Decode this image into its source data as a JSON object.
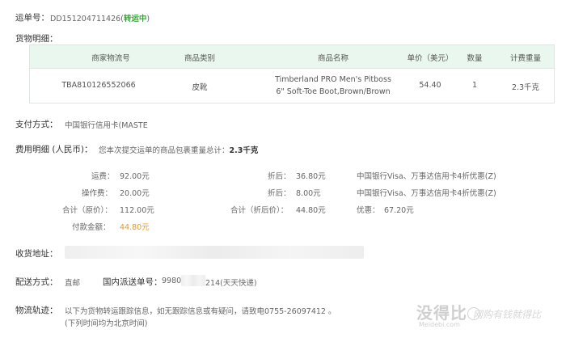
{
  "order": {
    "label": "运单号：",
    "number": "DD151204711426(",
    "status": "转运中",
    "close": ")"
  },
  "goods": {
    "label": "货物明细：",
    "headers": [
      "商家物流号",
      "商品类别",
      "商品名称",
      "单价（美元）",
      "数量",
      "计费重量"
    ],
    "row": {
      "tracking": "TBA810126552066",
      "category": "皮靴",
      "name": "Timberland PRO Men's Pitboss 6\" Soft-Toe Boot,Brown/Brown",
      "price": "54.40",
      "qty": "1",
      "weight": "2.3千克"
    }
  },
  "payment": {
    "label": "支付方式：",
    "method": "中国银行信用卡(MASTE"
  },
  "fees": {
    "label": "费用明细 (人民币)：",
    "summary_prefix": "您本次提交运单的商品包裹重量总计：",
    "summary_weight": "2.3千克",
    "freight_label": "运费：",
    "freight": "92.00元",
    "freight_disc_label": "折后：",
    "freight_disc": "36.80元",
    "freight_note": "中国银行Visa、万事达信用卡4折优惠(Z)",
    "handling_label": "操作费：",
    "handling": "20.00元",
    "handling_disc_label": "折后：",
    "handling_disc": "8.00元",
    "handling_note": "中国银行Visa、万事达信用卡4折优惠(Z)",
    "total_orig_label": "合计（原价）：",
    "total_orig": "112.00元",
    "total_disc_label": "合计（折后价）：",
    "total_disc": "44.80元",
    "saving_label": "优惠：",
    "saving": "67.20元",
    "paid_label": "付款金额：",
    "paid": "44.80元"
  },
  "address": {
    "label": "收货地址："
  },
  "delivery": {
    "label": "配送方式：",
    "method": "直邮",
    "domestic_label": "国内派送单号：",
    "number_prefix": "9980",
    "number_suffix": "214(天天快递)"
  },
  "logistics": {
    "label": "物流轨迹：",
    "line1": "以下为货物转运跟踪信息，如无跟踪信息或有疑问，请致电0755-26097412 。",
    "line2": "(下列时间均为北京时间)"
  },
  "watermark": {
    "brand": "没得比",
    "site": "Meidebi.com",
    "slogan": "网购有钱就得比"
  }
}
